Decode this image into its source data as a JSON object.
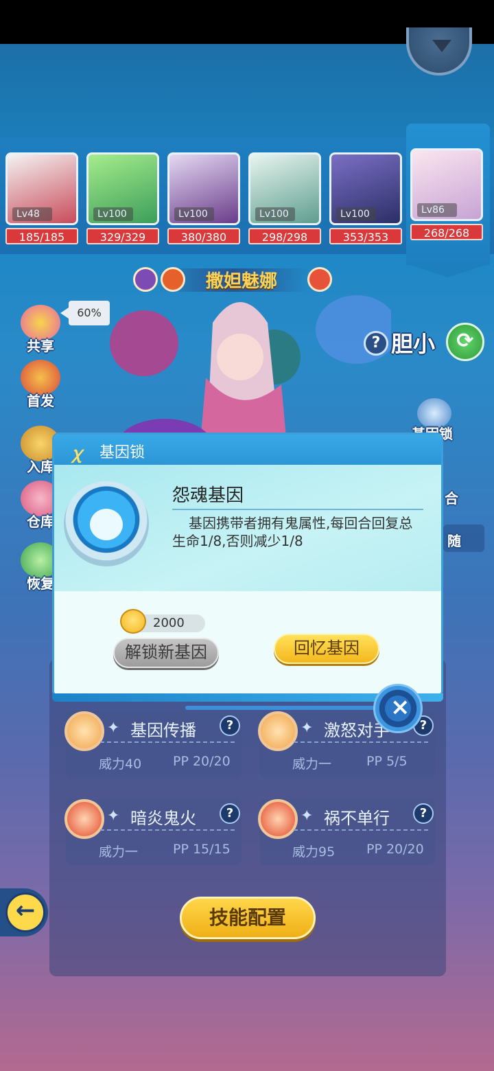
{
  "team": [
    {
      "lv": "Lv48",
      "hp": "185/185",
      "color": "#c94b5a"
    },
    {
      "lv": "Lv100",
      "hp": "329/329",
      "color": "#6dcf6f"
    },
    {
      "lv": "Lv100",
      "hp": "380/380",
      "color": "#9a6cb3"
    },
    {
      "lv": "Lv100",
      "hp": "298/298",
      "color": "#8fd0c6"
    },
    {
      "lv": "Lv100",
      "hp": "353/353",
      "color": "#4c4f8e"
    },
    {
      "lv": "Lv86",
      "hp": "268/268",
      "color": "#e7b9cf"
    }
  ],
  "pet": {
    "name": "撒妲魅娜",
    "trait": "胆小",
    "trait_q": "?"
  },
  "side_menu": {
    "exp_label": "共享",
    "exp_percent": "60%",
    "first_label": "首发",
    "warehouse_in_label": "入库",
    "warehouse_label": "仓库",
    "recover_label": "恢复"
  },
  "right_menu": {
    "gene_lock": "基因锁",
    "combine": "合",
    "follow": "随"
  },
  "modal": {
    "title": "基因锁",
    "gene_name": "怨魂基因",
    "gene_desc": "基因携带者拥有鬼属性,每回合回复总生命1/8,否则减少1/8",
    "cost": "2000",
    "unlock_button": "解锁新基因",
    "recall_button": "回忆基因"
  },
  "skills": [
    {
      "name": "基因传播",
      "power": "威力40",
      "pp": "PP 20/20",
      "color": "#f0a44b"
    },
    {
      "name": "激怒对手",
      "power": "威力一",
      "pp": "PP 5/5",
      "color": "#f0a44b"
    },
    {
      "name": "暗炎鬼火",
      "power": "威力一",
      "pp": "PP 15/15",
      "color": "#e24a2e"
    },
    {
      "name": "祸不单行",
      "power": "威力95",
      "pp": "PP 20/20",
      "color": "#e24a2e"
    }
  ],
  "skill_config_button": "技能配置"
}
